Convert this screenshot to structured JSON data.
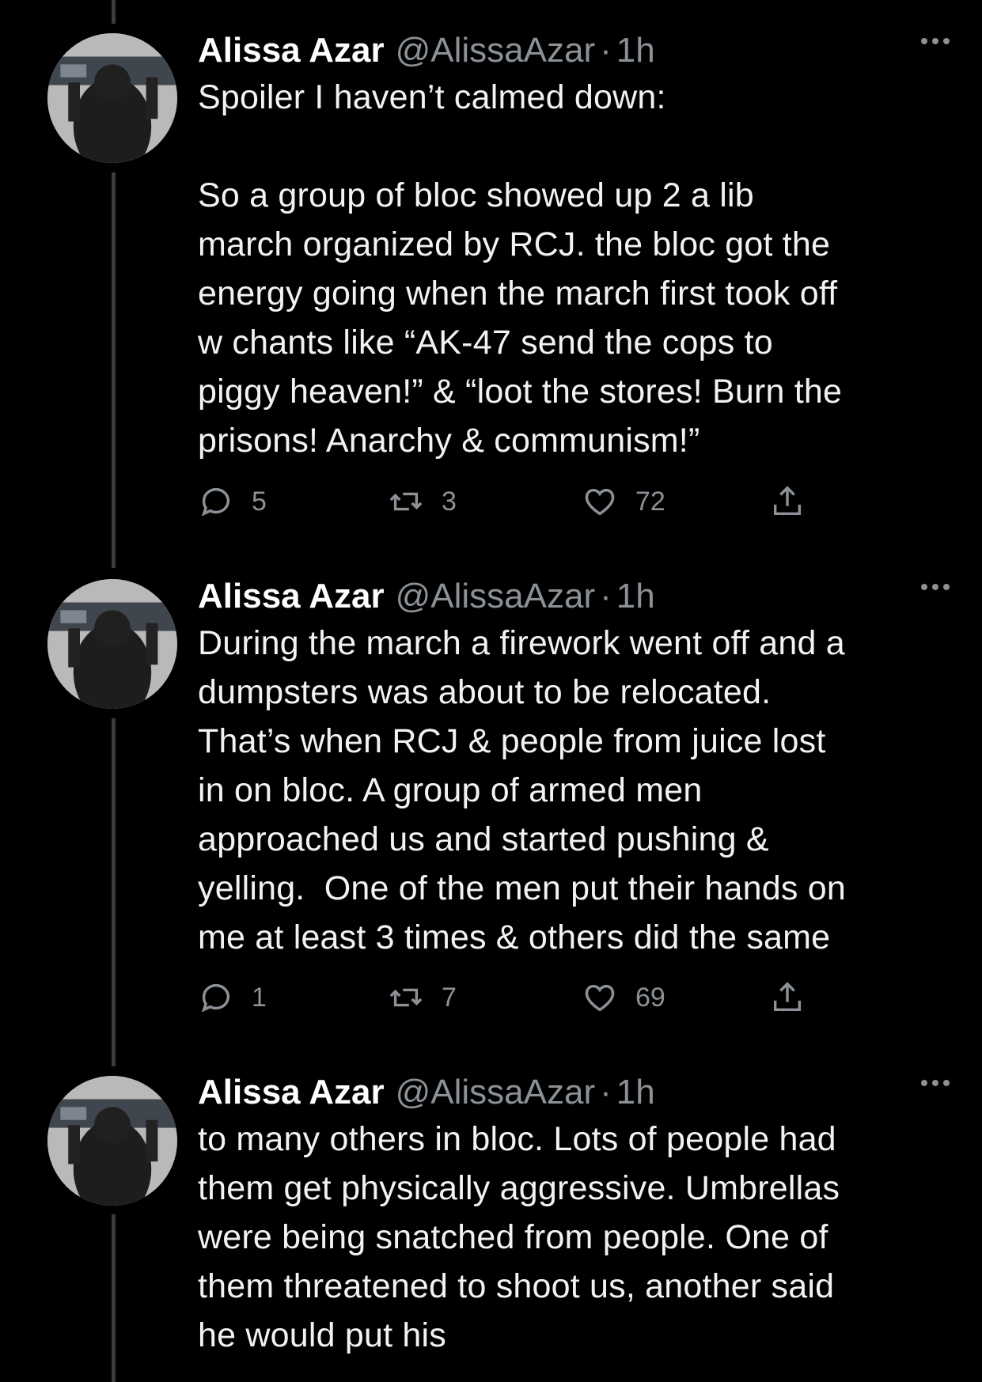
{
  "tweets": [
    {
      "name": "Alissa Azar",
      "handle": "@AlissaAzar",
      "dot": "·",
      "time": "1h",
      "text": "Spoiler I haven’t calmed down:\n\nSo a group of bloc showed up 2 a lib\nmarch organized by RCJ. the bloc got the\nenergy going when the march first took off\nw chants like “AK-47 send the cops to\npiggy heaven!” & “loot the stores! Burn the\nprisons! Anarchy & communism!”",
      "replies": "5",
      "retweets": "3",
      "likes": "72"
    },
    {
      "name": "Alissa Azar",
      "handle": "@AlissaAzar",
      "dot": "·",
      "time": "1h",
      "text": "During the march a firework went off and a\ndumpsters was about to be relocated.\nThat’s when RCJ & people from juice lost\nin on bloc. A group of armed men\napproached us and started pushing &\nyelling.  One of the men put their hands on\nme at least 3 times & others did the same",
      "replies": "1",
      "retweets": "7",
      "likes": "69"
    },
    {
      "name": "Alissa Azar",
      "handle": "@AlissaAzar",
      "dot": "·",
      "time": "1h",
      "text": "to many others in bloc. Lots of people had\nthem get physically aggressive. Umbrellas\nwere being snatched from people. One of\nthem threatened to shoot us, another said\nhe would put his"
    }
  ],
  "icons": {
    "reply": "reply-icon",
    "retweet": "retweet-icon",
    "like": "heart-icon",
    "share": "share-icon",
    "more": "more-icon"
  },
  "colors": {
    "background": "#000000",
    "muted": "#8b9196",
    "text": "#f2f2f2"
  }
}
